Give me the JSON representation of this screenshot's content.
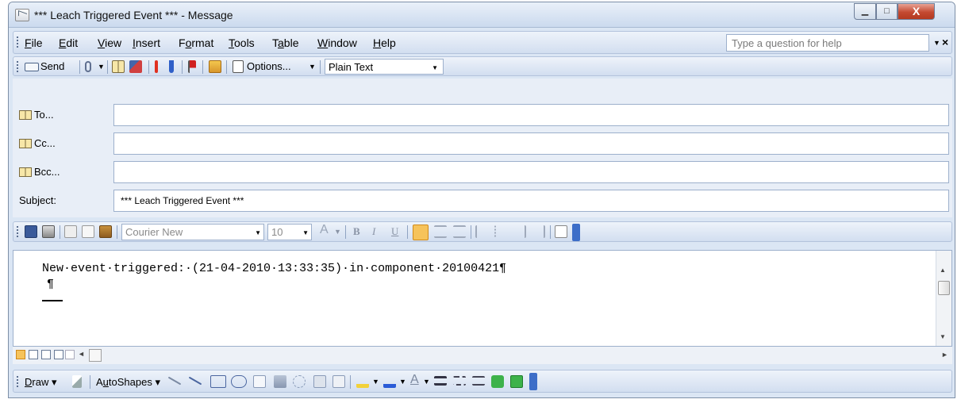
{
  "window": {
    "title": "*** Leach Triggered Event *** - Message",
    "controls": {
      "minimize": "▁",
      "maximize": "□",
      "close": "X"
    }
  },
  "menubar": {
    "items": [
      {
        "label": "File",
        "u": "F"
      },
      {
        "label": "Edit",
        "u": "E"
      },
      {
        "label": "View",
        "u": "V"
      },
      {
        "label": "Insert",
        "u": "I"
      },
      {
        "label": "Format",
        "u": "o"
      },
      {
        "label": "Tools",
        "u": "T"
      },
      {
        "label": "Table",
        "u": "a"
      },
      {
        "label": "Window",
        "u": "W"
      },
      {
        "label": "Help",
        "u": "H"
      }
    ],
    "help_placeholder": "Type a question for help",
    "close_glyph": "×"
  },
  "toolbar": {
    "send_label": "Send",
    "options_label": "Options...",
    "format_value": "Plain Text"
  },
  "fields": {
    "to_label": "To...",
    "cc_label": "Cc...",
    "bcc_label": "Bcc...",
    "subject_label": "Subject:",
    "to_value": "",
    "cc_value": "",
    "bcc_value": "",
    "subject_value": "*** Leach Triggered Event ***"
  },
  "formatting": {
    "font_value": "Courier New",
    "size_value": "10",
    "bold": "B",
    "italic": "I",
    "underline": "U"
  },
  "message": {
    "line1": "New·event·triggered:·(21-04-2010·13:33:35)·in·component·20100421¶",
    "line2": "¶"
  },
  "drawbar": {
    "draw_label": "Draw",
    "autoshapes_label": "AutoShapes"
  },
  "colors": {
    "accent": "#f2c14e",
    "window_bg": "#dbe6f4",
    "close_red": "#c44a31"
  }
}
